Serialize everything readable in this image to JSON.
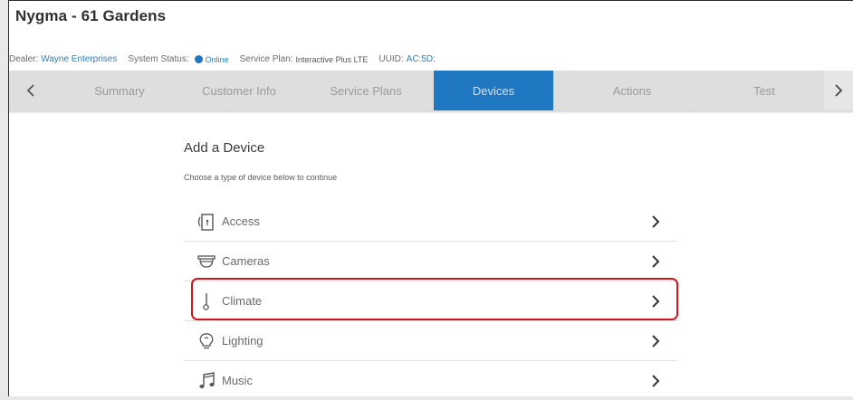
{
  "header": {
    "title": "Nygma - 61 Gardens"
  },
  "info": {
    "dealer_label": "Dealer:",
    "dealer_value": "Wayne Enterprises",
    "status_label": "System Status:",
    "status_value": "Online",
    "plan_label": "Service Plan:",
    "plan_value": "Interactive Plus LTE",
    "uuid_label": "UUID:",
    "uuid_value": "AC:5D:",
    "colors": {
      "link": "#2a7fc0",
      "status_dot": "#1f77c4"
    }
  },
  "tabs": {
    "prev_icon": "chevron-left-icon",
    "next_icon": "chevron-right-icon",
    "items": [
      {
        "label": "Summary",
        "active": false
      },
      {
        "label": "Customer Info",
        "active": false
      },
      {
        "label": "Service Plans",
        "active": false
      },
      {
        "label": "Devices",
        "active": true
      },
      {
        "label": "Actions",
        "active": false
      },
      {
        "label": "Test",
        "active": false
      }
    ],
    "active_color": "#1f78c1"
  },
  "main": {
    "heading": "Add a Device",
    "subheading": "Choose a type of device below to continue",
    "devices": [
      {
        "label": "Access",
        "icon": "door-access-icon"
      },
      {
        "label": "Cameras",
        "icon": "dome-camera-icon"
      },
      {
        "label": "Climate",
        "icon": "thermometer-icon",
        "highlighted": true
      },
      {
        "label": "Lighting",
        "icon": "lightbulb-icon"
      },
      {
        "label": "Music",
        "icon": "music-note-icon"
      }
    ],
    "highlight_color": "#d0161c"
  }
}
